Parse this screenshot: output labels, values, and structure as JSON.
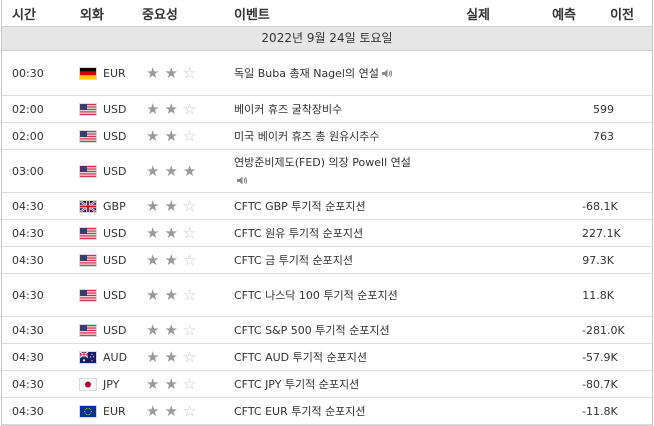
{
  "header": {
    "time": "시간",
    "currency": "외화",
    "importance": "중요성",
    "event": "이벤트",
    "actual": "실제",
    "forecast": "예측",
    "previous": "이전"
  },
  "date_label": "2022년 9월 24일 토요일",
  "rows": [
    {
      "time": "00:30",
      "currency": "EUR",
      "flag": "de",
      "stars": 2,
      "event": "독일 Buba 총재 Nagel의 연설",
      "speech": true,
      "actual": "",
      "forecast": "",
      "previous": ""
    },
    {
      "time": "02:00",
      "currency": "USD",
      "flag": "us",
      "stars": 2,
      "event": "베이커 휴즈 굴착장비수",
      "speech": false,
      "actual": "",
      "forecast": "",
      "previous": "599"
    },
    {
      "time": "02:00",
      "currency": "USD",
      "flag": "us",
      "stars": 2,
      "event": "미국 베이커 휴즈 총 원유시추수",
      "speech": false,
      "actual": "",
      "forecast": "",
      "previous": "763"
    },
    {
      "time": "03:00",
      "currency": "USD",
      "flag": "us",
      "stars": 3,
      "event": "연방준비제도(FED) 의장 Powell 연설",
      "speech": true,
      "actual": "",
      "forecast": "",
      "previous": ""
    },
    {
      "time": "04:30",
      "currency": "GBP",
      "flag": "gb",
      "stars": 2,
      "event": "CFTC GBP 투기적 순포지션",
      "speech": false,
      "actual": "",
      "forecast": "",
      "previous": "-68.1K"
    },
    {
      "time": "04:30",
      "currency": "USD",
      "flag": "us",
      "stars": 2,
      "event": "CFTC 원유 투기적 순포지션",
      "speech": false,
      "actual": "",
      "forecast": "",
      "previous": "227.1K"
    },
    {
      "time": "04:30",
      "currency": "USD",
      "flag": "us",
      "stars": 2,
      "event": "CFTC 금 투기적 순포지션",
      "speech": false,
      "actual": "",
      "forecast": "",
      "previous": "97.3K"
    },
    {
      "time": "04:30",
      "currency": "USD",
      "flag": "us",
      "stars": 2,
      "event": "CFTC 나스닥 100 투기적 순포지션",
      "speech": false,
      "actual": "",
      "forecast": "",
      "previous": "11.8K"
    },
    {
      "time": "04:30",
      "currency": "USD",
      "flag": "us",
      "stars": 2,
      "event": "CFTC S&P 500 투기적 순포지션",
      "speech": false,
      "actual": "",
      "forecast": "",
      "previous": "-281.0K"
    },
    {
      "time": "04:30",
      "currency": "AUD",
      "flag": "au",
      "stars": 2,
      "event": "CFTC AUD 투기적 순포지션",
      "speech": false,
      "actual": "",
      "forecast": "",
      "previous": "-57.9K"
    },
    {
      "time": "04:30",
      "currency": "JPY",
      "flag": "jp",
      "stars": 2,
      "event": "CFTC JPY 투기적 순포지션",
      "speech": false,
      "actual": "",
      "forecast": "",
      "previous": "-80.7K"
    },
    {
      "time": "04:30",
      "currency": "EUR",
      "flag": "eu",
      "stars": 2,
      "event": "CFTC EUR 투기적 순포지션",
      "speech": false,
      "actual": "",
      "forecast": "",
      "previous": "-11.8K"
    }
  ]
}
